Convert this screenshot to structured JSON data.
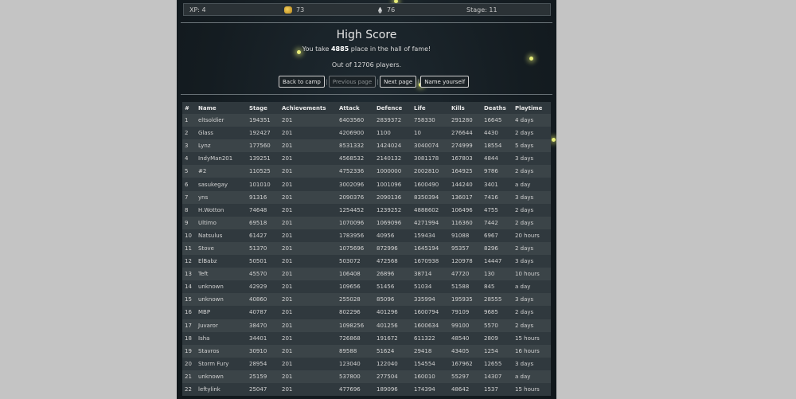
{
  "topbar": {
    "xp": "XP: 4",
    "coins": "73",
    "flames": "76",
    "stage": "Stage: 11"
  },
  "title": "High Score",
  "subtitle": {
    "prefix": "You take ",
    "rank": "4885",
    "suffix": " place in the hall of fame!"
  },
  "players": "Out of 12706 players.",
  "buttons": {
    "back": "Back to camp",
    "previous": "Previous page",
    "next": "Next page",
    "name": "Name yourself",
    "separator": "|"
  },
  "table": {
    "columns": [
      "#",
      "Name",
      "Stage",
      "Achievements",
      "Attack",
      "Defence",
      "Life",
      "Kills",
      "Deaths",
      "Playtime"
    ],
    "rows": [
      [
        "1",
        "eltsoldier",
        "194351",
        "201",
        "6403560",
        "2839372",
        "758330",
        "291280",
        "16645",
        "4 days"
      ],
      [
        "2",
        "Glass",
        "192427",
        "201",
        "4206900",
        "1100",
        "10",
        "276644",
        "4430",
        "2 days"
      ],
      [
        "3",
        "Lynz",
        "177560",
        "201",
        "8531332",
        "1424024",
        "3040074",
        "274999",
        "18554",
        "5 days"
      ],
      [
        "4",
        "IndyMan201",
        "139251",
        "201",
        "4568532",
        "2140132",
        "3081178",
        "167803",
        "4844",
        "3 days"
      ],
      [
        "5",
        "#2",
        "110525",
        "201",
        "4752336",
        "1000000",
        "2002810",
        "164925",
        "9786",
        "2 days"
      ],
      [
        "6",
        "sasukegay",
        "101010",
        "201",
        "3002096",
        "1001096",
        "1600490",
        "144240",
        "3401",
        "a day"
      ],
      [
        "7",
        "yns",
        "91316",
        "201",
        "2090376",
        "2090136",
        "8350394",
        "136017",
        "7416",
        "3 days"
      ],
      [
        "8",
        "H.Wotton",
        "74648",
        "201",
        "1254452",
        "1239252",
        "4888602",
        "106496",
        "4755",
        "2 days"
      ],
      [
        "9",
        "Ultimo",
        "69518",
        "201",
        "1070096",
        "1069096",
        "4271994",
        "116360",
        "7442",
        "2 days"
      ],
      [
        "10",
        "Natsulus",
        "61427",
        "201",
        "1783956",
        "40956",
        "159434",
        "91088",
        "6967",
        "20 hours"
      ],
      [
        "11",
        "Stove",
        "51370",
        "201",
        "1075696",
        "872996",
        "1645194",
        "95357",
        "8296",
        "2 days"
      ],
      [
        "12",
        "ElBabz",
        "50501",
        "201",
        "503072",
        "472568",
        "1670938",
        "120978",
        "14447",
        "3 days"
      ],
      [
        "13",
        "Teft",
        "45570",
        "201",
        "106408",
        "26896",
        "38714",
        "47720",
        "130",
        "10 hours"
      ],
      [
        "14",
        "unknown",
        "42929",
        "201",
        "109656",
        "51456",
        "51034",
        "51588",
        "845",
        "a day"
      ],
      [
        "15",
        "unknown",
        "40860",
        "201",
        "255028",
        "85096",
        "335994",
        "195935",
        "28555",
        "3 days"
      ],
      [
        "16",
        "MBP",
        "40787",
        "201",
        "802296",
        "401296",
        "1600794",
        "79109",
        "9685",
        "2 days"
      ],
      [
        "17",
        "Juvaror",
        "38470",
        "201",
        "1098256",
        "401256",
        "1600634",
        "99100",
        "5570",
        "2 days"
      ],
      [
        "18",
        "Isha",
        "34401",
        "201",
        "726868",
        "191672",
        "611322",
        "48540",
        "2809",
        "15 hours"
      ],
      [
        "19",
        "Stavros",
        "30910",
        "201",
        "89588",
        "51624",
        "29418",
        "43405",
        "1254",
        "16 hours"
      ],
      [
        "20",
        "Storm Fury",
        "28954",
        "201",
        "123040",
        "122040",
        "154554",
        "167962",
        "12655",
        "3 days"
      ],
      [
        "21",
        "unknown",
        "25159",
        "201",
        "537800",
        "277504",
        "160010",
        "55297",
        "14307",
        "a day"
      ],
      [
        "22",
        "leftylink",
        "25047",
        "201",
        "477696",
        "189096",
        "174394",
        "48642",
        "1537",
        "15 hours"
      ]
    ]
  },
  "icons": {
    "coins": "coin-stack-icon",
    "flames": "flame-icon"
  },
  "colors": {
    "background": "#141c21",
    "row_odd": "#3b4448",
    "row_even": "#30393e",
    "header_row": "#2f383d",
    "firefly": "#e8ee7a"
  }
}
